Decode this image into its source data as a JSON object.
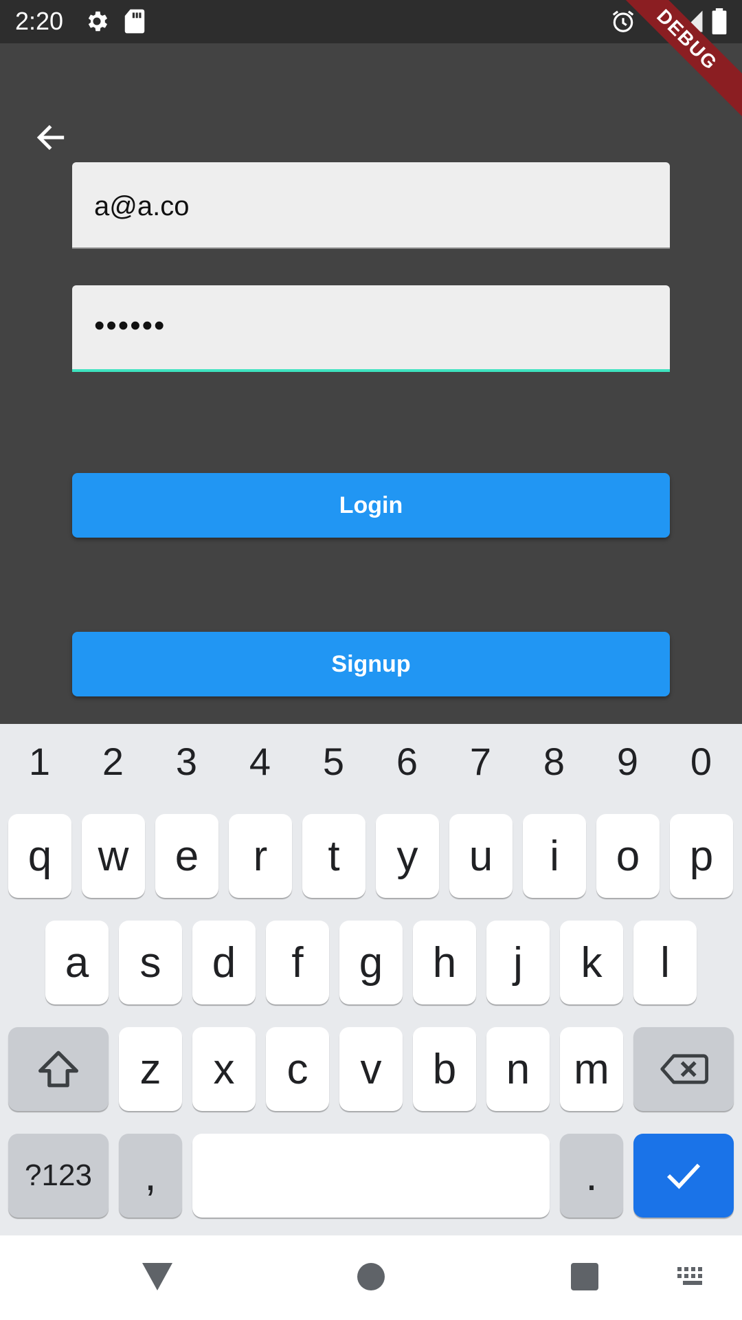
{
  "status_bar": {
    "time": "2:20",
    "icons": [
      "settings-icon",
      "sd-card-icon",
      "alarm-icon",
      "wifi-icon",
      "signal-icon",
      "battery-icon"
    ]
  },
  "debug_banner": "DEBUG",
  "form": {
    "email_value": "a@a.co",
    "password_value": "••••••",
    "login_label": "Login",
    "signup_label": "Signup"
  },
  "colors": {
    "background": "#434343",
    "button": "#2196f3",
    "focus_underline": "#3fe3c0",
    "done_key": "#1a73e8"
  },
  "keyboard": {
    "numbers": [
      "1",
      "2",
      "3",
      "4",
      "5",
      "6",
      "7",
      "8",
      "9",
      "0"
    ],
    "row1": [
      "q",
      "w",
      "e",
      "r",
      "t",
      "y",
      "u",
      "i",
      "o",
      "p"
    ],
    "row2": [
      "a",
      "s",
      "d",
      "f",
      "g",
      "h",
      "j",
      "k",
      "l"
    ],
    "row3": [
      "z",
      "x",
      "c",
      "v",
      "b",
      "n",
      "m"
    ],
    "symbols_label": "?123",
    "comma": ",",
    "period": "."
  }
}
